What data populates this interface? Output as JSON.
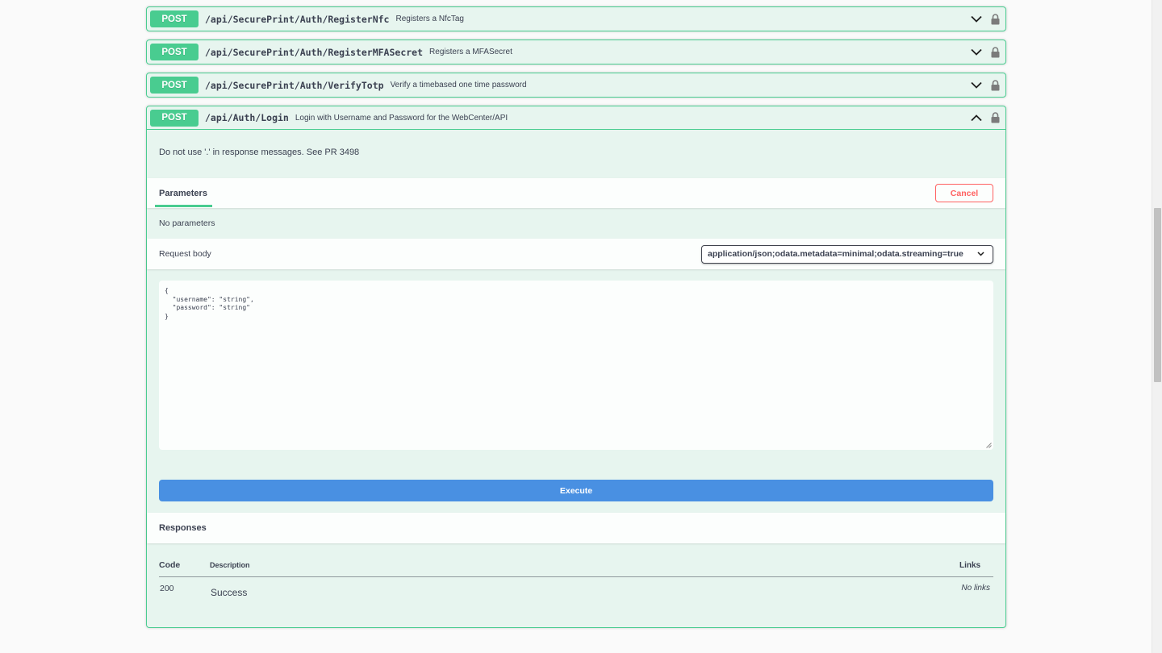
{
  "operations": [
    {
      "method": "POST",
      "path": "/api/SecurePrint/Auth/RegisterNfc",
      "summary": "Registers a NfcTag"
    },
    {
      "method": "POST",
      "path": "/api/SecurePrint/Auth/RegisterMFASecret",
      "summary": "Registers a MFASecret"
    },
    {
      "method": "POST",
      "path": "/api/SecurePrint/Auth/VerifyTotp",
      "summary": "Verify a timebased one time password"
    },
    {
      "method": "POST",
      "path": "/api/Auth/Login",
      "summary": "Login with Username and Password for the WebCenter/API"
    }
  ],
  "expanded": {
    "description": "Do not use '.' in response messages. See PR 3498",
    "parameters_tab": "Parameters",
    "cancel_label": "Cancel",
    "no_parameters": "No parameters",
    "request_body_label": "Request body",
    "content_type": "application/json;odata.metadata=minimal;odata.streaming=true",
    "request_body": "{\n  \"username\": \"string\",\n  \"password\": \"string\"\n}",
    "execute_label": "Execute",
    "responses_title": "Responses",
    "responses_table": {
      "headers": {
        "code": "Code",
        "description": "Description",
        "links": "Links"
      },
      "rows": [
        {
          "code": "200",
          "description": "Success",
          "links": "No links"
        }
      ]
    }
  },
  "colors": {
    "post": "#49cc90",
    "execute": "#4990e2",
    "cancel": "#ff6060"
  },
  "icons": {
    "collapse": "chevron-down-icon",
    "expand": "chevron-up-icon",
    "lock": "lock-icon"
  }
}
